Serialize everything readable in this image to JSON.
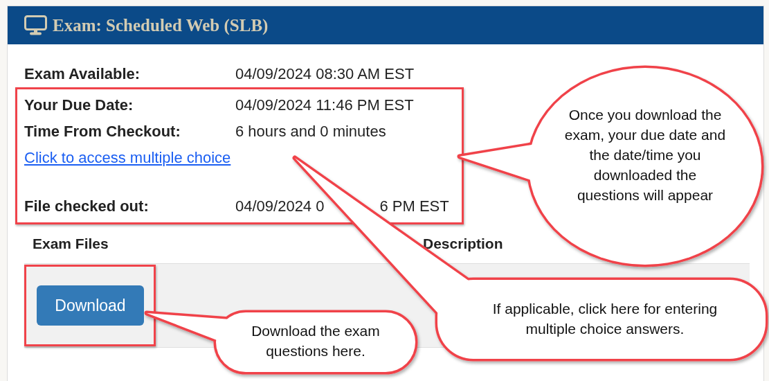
{
  "header": {
    "title": "Exam: Scheduled Web (SLB)"
  },
  "summary_rows": [
    {
      "label": "Exam Available:",
      "value": "04/09/2024 08:30 AM EST"
    }
  ],
  "highlight_box": {
    "rows": [
      {
        "label": "Your Due Date:",
        "value": "04/09/2024 11:46 PM EST"
      },
      {
        "label": "Time From Checkout:",
        "value": "6 hours and 0 minutes"
      }
    ],
    "link": "Click to access multiple choice",
    "checked_out": {
      "label": "File checked out:",
      "value_visible_start": "04/09/2024 0",
      "value_visible_end": "6 PM EST"
    }
  },
  "table": {
    "columns": [
      "Exam Files",
      "Description"
    ],
    "rows": [
      {
        "button": "Download"
      }
    ]
  },
  "callouts": [
    {
      "kind": "oval",
      "text": "Once you download the exam, your due date and the date/time you downloaded the questions will appear"
    },
    {
      "kind": "rounded",
      "text": "If applicable, click here for entering multiple choice answers."
    },
    {
      "kind": "rounded",
      "text": "Download the exam questions here."
    }
  ]
}
